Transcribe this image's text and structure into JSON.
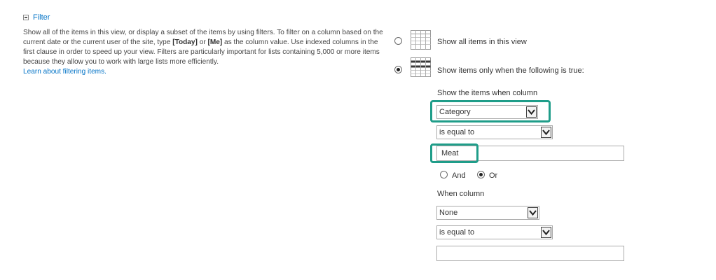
{
  "section": {
    "title": "Filter",
    "description_part1": "Show all of the items in this view, or display a subset of the items by using filters. To filter on a column based on the current date or the current user of the site, type ",
    "token_today": "[Today]",
    "description_or": " or ",
    "token_me": "[Me]",
    "description_part2": " as the column value. Use indexed columns in the first clause in order to speed up your view. Filters are particularly important for lists containing 5,000 or more items because they allow you to work with large lists more efficiently.",
    "learn_link": "Learn about filtering items."
  },
  "options": {
    "show_all": "Show all items in this view",
    "show_filtered": "Show items only when the following is true:"
  },
  "filter1": {
    "label": "Show the items when column",
    "column_value": "Category",
    "operator_value": "is equal to",
    "value": "Meat"
  },
  "logic": {
    "and_label": "And",
    "or_label": "Or"
  },
  "filter2": {
    "label": "When column",
    "column_value": "None",
    "operator_value": "is equal to",
    "value": ""
  },
  "colors": {
    "link": "#0072c6",
    "highlight": "#1f9d89"
  }
}
